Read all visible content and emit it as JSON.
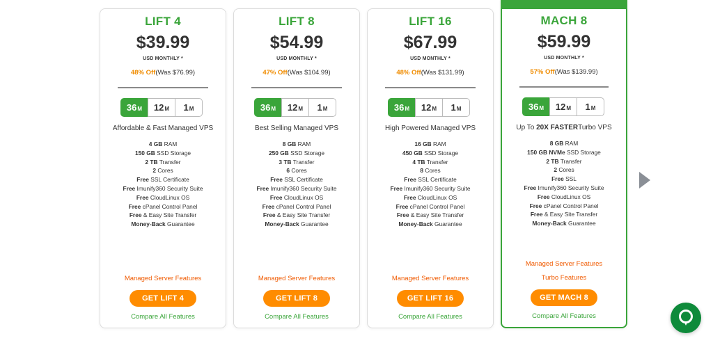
{
  "colors": {
    "accent_green": "#3aa53a",
    "orange": "#ff8c00",
    "link_orange": "#f05a00",
    "chat_green": "#0e8a3a"
  },
  "plans": [
    {
      "name": "LIFT 4",
      "price": "$39.99",
      "period": "USD MONTHLY *",
      "discount_off": "48% Off",
      "discount_was": "(Was $76.99)",
      "terms": [
        {
          "num": "36",
          "unit": "M"
        },
        {
          "num": "12",
          "unit": "M"
        },
        {
          "num": "1",
          "unit": "M"
        }
      ],
      "selected_term": "36M",
      "tagline": "Affordable & Fast Managed VPS",
      "features": [
        {
          "bold": "4 GB",
          "rest": " RAM"
        },
        {
          "bold": "150 GB",
          "rest": " SSD Storage"
        },
        {
          "bold": "2 TB",
          "rest": " Transfer"
        },
        {
          "bold": "2",
          "rest": " Cores"
        },
        {
          "bold": "Free",
          "rest": " SSL Certificate"
        },
        {
          "bold": "Free",
          "rest": " Imunify360 Security Suite"
        },
        {
          "bold": "Free",
          "rest": " CloudLinux OS"
        },
        {
          "bold": "Free",
          "rest": " cPanel Control Panel"
        },
        {
          "bold": "Free",
          "rest": " & Easy Site Transfer"
        },
        {
          "bold": "Money-Back",
          "rest": " Guarantee"
        }
      ],
      "links": [
        "Managed Server Features"
      ],
      "cta": "GET LIFT 4",
      "compare": "Compare All Features"
    },
    {
      "name": "LIFT 8",
      "price": "$54.99",
      "period": "USD MONTHLY *",
      "discount_off": "47% Off",
      "discount_was": "(Was $104.99)",
      "terms": [
        {
          "num": "36",
          "unit": "M"
        },
        {
          "num": "12",
          "unit": "M"
        },
        {
          "num": "1",
          "unit": "M"
        }
      ],
      "selected_term": "36M",
      "tagline": "Best Selling Managed VPS",
      "features": [
        {
          "bold": "8 GB",
          "rest": " RAM"
        },
        {
          "bold": "250 GB",
          "rest": " SSD Storage"
        },
        {
          "bold": "3 TB",
          "rest": " Transfer"
        },
        {
          "bold": "6",
          "rest": " Cores"
        },
        {
          "bold": "Free",
          "rest": " SSL Certificate"
        },
        {
          "bold": "Free",
          "rest": " Imunify360 Security Suite"
        },
        {
          "bold": "Free",
          "rest": " CloudLinux OS"
        },
        {
          "bold": "Free",
          "rest": " cPanel Control Panel"
        },
        {
          "bold": "Free",
          "rest": " & Easy Site Transfer"
        },
        {
          "bold": "Money-Back",
          "rest": " Guarantee"
        }
      ],
      "links": [
        "Managed Server Features"
      ],
      "cta": "GET LIFT 8",
      "compare": "Compare All Features"
    },
    {
      "name": "LIFT 16",
      "price": "$67.99",
      "period": "USD MONTHLY *",
      "discount_off": "48% Off",
      "discount_was": "(Was $131.99)",
      "terms": [
        {
          "num": "36",
          "unit": "M"
        },
        {
          "num": "12",
          "unit": "M"
        },
        {
          "num": "1",
          "unit": "M"
        }
      ],
      "selected_term": "36M",
      "tagline": "High Powered Managed VPS",
      "features": [
        {
          "bold": "16 GB",
          "rest": " RAM"
        },
        {
          "bold": "450 GB",
          "rest": " SSD Storage"
        },
        {
          "bold": "4 TB",
          "rest": " Transfer"
        },
        {
          "bold": "8",
          "rest": " Cores"
        },
        {
          "bold": "Free",
          "rest": " SSL Certificate"
        },
        {
          "bold": "Free",
          "rest": " Imunify360 Security Suite"
        },
        {
          "bold": "Free",
          "rest": " CloudLinux OS"
        },
        {
          "bold": "Free",
          "rest": " cPanel Control Panel"
        },
        {
          "bold": "Free",
          "rest": " & Easy Site Transfer"
        },
        {
          "bold": "Money-Back",
          "rest": " Guarantee"
        }
      ],
      "links": [
        "Managed Server Features"
      ],
      "cta": "GET LIFT 16",
      "compare": "Compare All Features"
    },
    {
      "name": "MACH 8",
      "price": "$59.99",
      "period": "USD MONTHLY *",
      "discount_off": "57% Off",
      "discount_was": "(Was $139.99)",
      "terms": [
        {
          "num": "36",
          "unit": "M"
        },
        {
          "num": "12",
          "unit": "M"
        },
        {
          "num": "1",
          "unit": "M"
        }
      ],
      "selected_term": "36M",
      "tagline_pre": "Up To ",
      "tagline_bold": "20X FASTER",
      "tagline_post": "Turbo VPS",
      "features": [
        {
          "bold": "8 GB",
          "rest": " RAM"
        },
        {
          "bold": "150 GB NVMe",
          "rest": " SSD Storage"
        },
        {
          "bold": "2 TB",
          "rest": " Transfer"
        },
        {
          "bold": "2",
          "rest": " Cores"
        },
        {
          "bold": "Free",
          "rest": " SSL"
        },
        {
          "bold": "Free",
          "rest": " Imunify360 Security Suite"
        },
        {
          "bold": "Free",
          "rest": " CloudLinux OS"
        },
        {
          "bold": "Free",
          "rest": " cPanel Control Panel"
        },
        {
          "bold": "Free",
          "rest": " & Easy Site Transfer"
        },
        {
          "bold": "Money-Back",
          "rest": " Guarantee"
        }
      ],
      "links": [
        "Managed Server Features",
        "Turbo Features"
      ],
      "cta": "GET MACH 8",
      "compare": "Compare All Features"
    }
  ],
  "icons": {
    "next": "chevron-right-icon",
    "chat": "chat-bubble-icon"
  }
}
